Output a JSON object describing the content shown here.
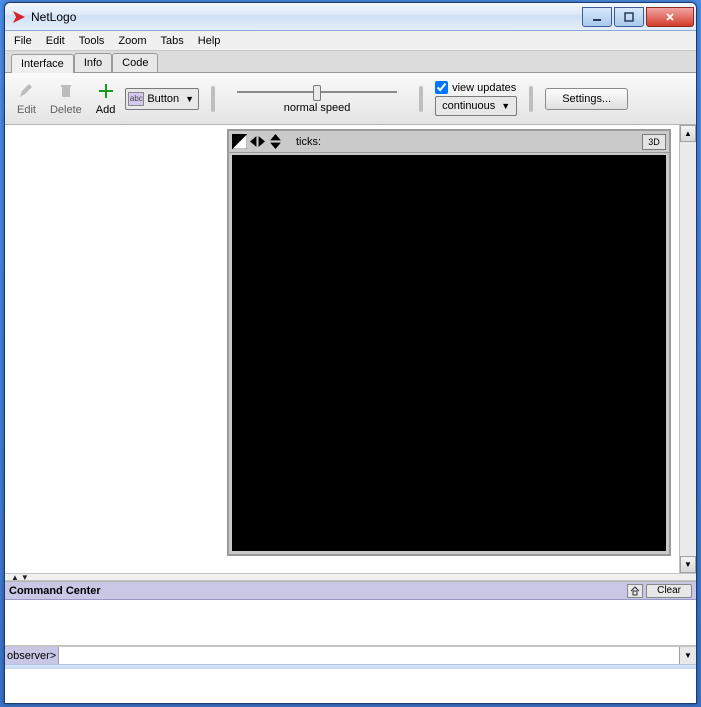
{
  "window": {
    "title": "NetLogo"
  },
  "menubar": {
    "items": [
      "File",
      "Edit",
      "Tools",
      "Zoom",
      "Tabs",
      "Help"
    ]
  },
  "tabs": {
    "items": [
      "Interface",
      "Info",
      "Code"
    ],
    "active": 0
  },
  "toolbar": {
    "edit_label": "Edit",
    "delete_label": "Delete",
    "add_label": "Add",
    "type_selector": {
      "swatch_text": "abc",
      "label": "Button"
    },
    "speed_label": "normal speed",
    "view_updates": {
      "checked": true,
      "label": "view updates"
    },
    "update_mode": {
      "label": "continuous"
    },
    "settings_label": "Settings..."
  },
  "world": {
    "ticks_label": "ticks:",
    "btn3d_label": "3D"
  },
  "command_center": {
    "title": "Command Center",
    "clear_label": "Clear",
    "prompt": "observer>",
    "input_value": ""
  }
}
